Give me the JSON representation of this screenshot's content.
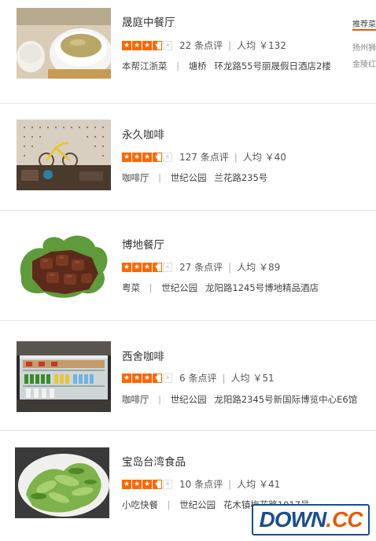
{
  "restaurants": [
    {
      "name": "晟庭中餐厅",
      "rating": 3.5,
      "reviews": "22 条点评",
      "price": "人均 ￥132",
      "cuisine": "本帮江浙菜",
      "area": "塘桥",
      "address": "环龙路55号丽晟假日酒店2楼",
      "image": "soup-bowl"
    },
    {
      "name": "永久咖啡",
      "rating": 3.5,
      "reviews": "127 条点评",
      "price": "人均 ￥40",
      "cuisine": "咖啡厅",
      "area": "世纪公园",
      "address": "兰花路235号",
      "image": "cafe-interior"
    },
    {
      "name": "博地餐厅",
      "rating": 3.5,
      "reviews": "27 条点评",
      "price": "人均 ￥89",
      "cuisine": "粤菜",
      "area": "世纪公园",
      "address": "龙阳路1245号博地精品酒店",
      "image": "braised-ribs"
    },
    {
      "name": "西舍咖啡",
      "rating": 3.5,
      "reviews": "6 条点评",
      "price": "人均 ￥51",
      "cuisine": "咖啡厅",
      "area": "世纪公园",
      "address": "龙阳路2345号新国际博览中心E6馆",
      "image": "drink-fridge"
    },
    {
      "name": "宝岛台湾食品",
      "rating": 3.5,
      "reviews": "10 条点评",
      "price": "人均 ￥41",
      "cuisine": "小吃快餐",
      "area": "世纪公园",
      "address": "花木镇梅花路1017号",
      "image": "green-vegetables"
    }
  ],
  "side_panel": {
    "title": "推荐菜",
    "items": [
      "扬州狮子",
      "金陵红烧"
    ]
  },
  "watermark": {
    "part1": "DOWN",
    "dot": ".",
    "part2": "CC"
  },
  "colors": {
    "accent": "#ff6600",
    "divider": "#e6e6e6",
    "watermark_blue": "#1b4e8a"
  }
}
